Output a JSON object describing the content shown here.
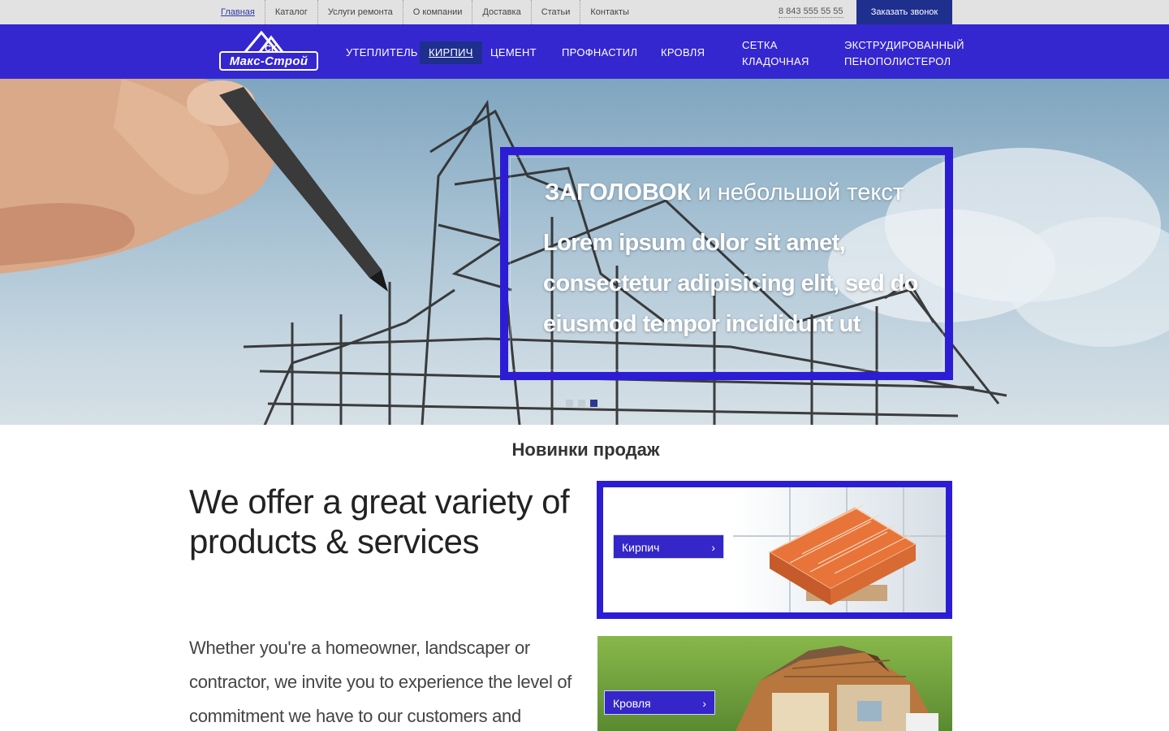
{
  "topbar": {
    "links": [
      {
        "label": "Главная",
        "active": true
      },
      {
        "label": "Каталог"
      },
      {
        "label": "Услуги ремонта"
      },
      {
        "label": "О компании"
      },
      {
        "label": "Доставка"
      },
      {
        "label": "Статьи"
      },
      {
        "label": "Контакты"
      }
    ],
    "phone": "8 843 555 55 55",
    "callback_label": "Заказать звонок"
  },
  "logo": {
    "small_text": "СК",
    "name": "Макс-Строй"
  },
  "menu": {
    "items": [
      {
        "label": "Утеплитель"
      },
      {
        "label": "Кирпич",
        "active": true
      },
      {
        "label": "Цемент"
      },
      {
        "label": "Профнастил"
      },
      {
        "label": "Кровля"
      },
      {
        "label": "Сетка кладочная"
      },
      {
        "label": "Экструдированный пенополистерол"
      }
    ]
  },
  "hero": {
    "title_bold": "ЗАГОЛОВОК",
    "title_rest": " и небольшой текст",
    "text": "Lorem ipsum dolor sit amet, consectetur adipisicing elit, sed do eiusmod tempor incididunt ut",
    "slides": 3,
    "active_slide": 3
  },
  "content": {
    "section_title": "Новинки продаж",
    "offer_heading": "We offer a great variety of products & services",
    "description": "Whether you're a homeowner, landscaper or contractor, we invite you to experience the level of commitment we have to our customers and"
  },
  "cards": [
    {
      "label": "Кирпич",
      "image": "bricks-on-pallet"
    },
    {
      "label": "Кровля",
      "image": "house-cutaway"
    }
  ],
  "colors": {
    "nav": "#3527cf",
    "accent_dark": "#1e2f8e",
    "frame": "#2c1dd4",
    "topbar": "#e2e2e2"
  },
  "icons": {
    "chevron": "chevron-right-icon"
  }
}
